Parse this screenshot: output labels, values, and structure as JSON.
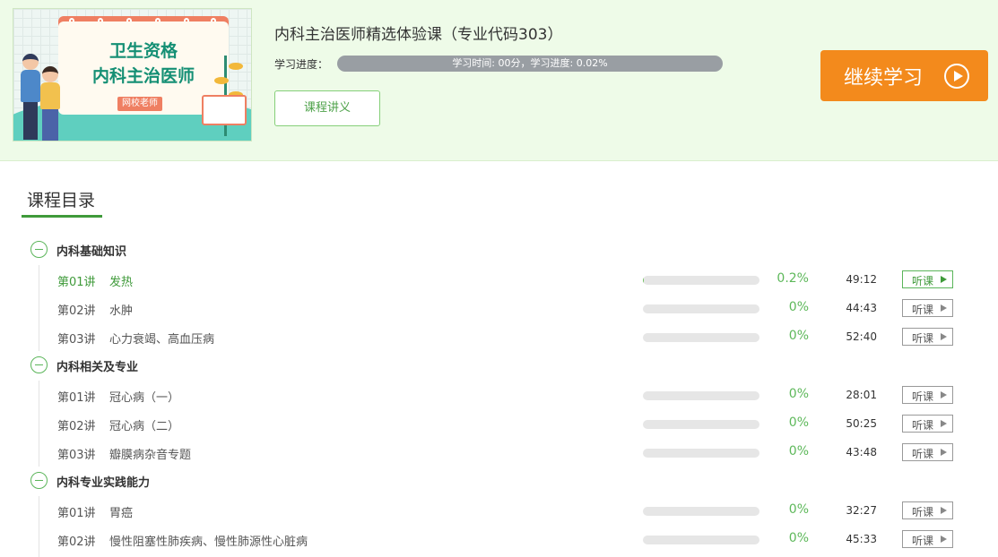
{
  "course": {
    "thumbnail": {
      "line1": "卫生资格",
      "line2": "内科主治医师",
      "tag": "网校老师"
    },
    "title": "内科主治医师精选体验课（专业代码303）",
    "progress_label": "学习进度：",
    "progress_text": "学习时间: 00分，学习进度: 0.02%",
    "handout_label": "课程讲义",
    "continue_label": "继续学习"
  },
  "catalog": {
    "title": "课程目录",
    "sections": [
      {
        "name": "内科基础知识",
        "lessons": [
          {
            "num": "第01讲",
            "title": "发热",
            "percent": "0.2%",
            "progress": 0.002,
            "duration": "49:12",
            "listen": "听课",
            "active": true
          },
          {
            "num": "第02讲",
            "title": "水肿",
            "percent": "0%",
            "progress": 0,
            "duration": "44:43",
            "listen": "听课",
            "active": false
          },
          {
            "num": "第03讲",
            "title": "心力衰竭、高血压病",
            "percent": "0%",
            "progress": 0,
            "duration": "52:40",
            "listen": "听课",
            "active": false
          }
        ]
      },
      {
        "name": "内科相关及专业",
        "lessons": [
          {
            "num": "第01讲",
            "title": "冠心病（一）",
            "percent": "0%",
            "progress": 0,
            "duration": "28:01",
            "listen": "听课",
            "active": false
          },
          {
            "num": "第02讲",
            "title": "冠心病（二）",
            "percent": "0%",
            "progress": 0,
            "duration": "50:25",
            "listen": "听课",
            "active": false
          },
          {
            "num": "第03讲",
            "title": "瓣膜病杂音专题",
            "percent": "0%",
            "progress": 0,
            "duration": "43:48",
            "listen": "听课",
            "active": false
          }
        ]
      },
      {
        "name": "内科专业实践能力",
        "lessons": [
          {
            "num": "第01讲",
            "title": "胃癌",
            "percent": "0%",
            "progress": 0,
            "duration": "32:27",
            "listen": "听课",
            "active": false
          },
          {
            "num": "第02讲",
            "title": "慢性阻塞性肺疾病、慢性肺源性心脏病",
            "percent": "0%",
            "progress": 0,
            "duration": "45:33",
            "listen": "听课",
            "active": false
          }
        ]
      }
    ]
  },
  "colors": {
    "accent_green": "#3f9a3a",
    "continue_orange": "#f38a1c",
    "header_bg": "#eefbe8"
  },
  "icons": {
    "collapse": "minus-circle-icon",
    "play": "play-circle-icon",
    "listen": "play-triangle-icon"
  }
}
